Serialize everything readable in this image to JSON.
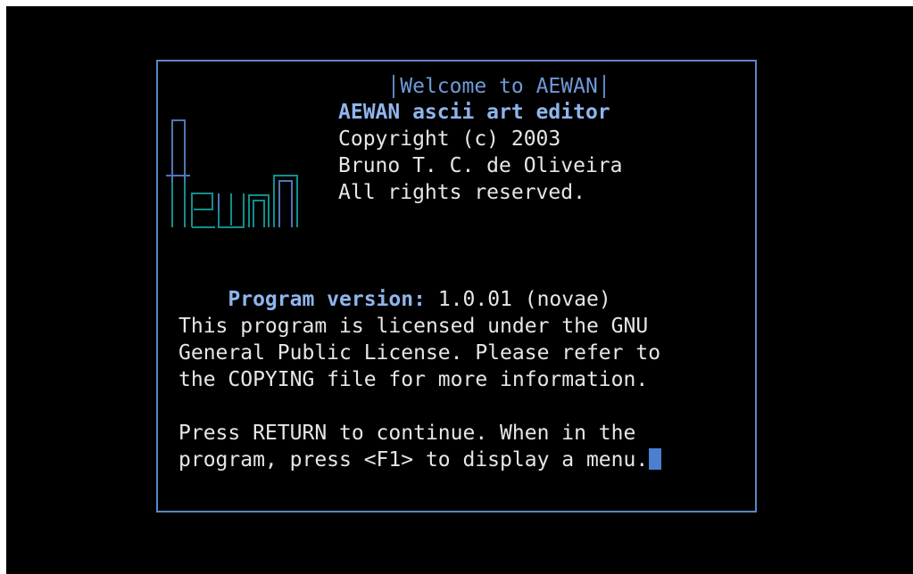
{
  "dialog": {
    "title": "Welcome to AEWAN"
  },
  "about": {
    "app_name": "AEWAN ascii art editor",
    "copyright": "Copyright (c) 2003",
    "author": "Bruno T. C. de Oliveira",
    "rights": "All rights reserved."
  },
  "version": {
    "label": "Program version:",
    "value": "1.0.01 (novae)"
  },
  "license": {
    "line1": "This program is licensed under the GNU",
    "line2": "General Public License. Please refer to",
    "line3": "the COPYING file for more information."
  },
  "instructions": {
    "line1": "Press RETURN to continue. When in the",
    "line2": "program, press <F1> to display a menu."
  },
  "logo": {
    "text": "Aewan",
    "icon": "aewan-logo-icon"
  },
  "colors": {
    "background": "#000000",
    "border": "#5a87c5",
    "title": "#6f9ad8",
    "bold_text": "#8fb5ec",
    "text": "#e6e6e6",
    "logo_teal": "#0f8f8c",
    "logo_blue": "#4f76b8",
    "cursor": "#4b7fd0"
  }
}
